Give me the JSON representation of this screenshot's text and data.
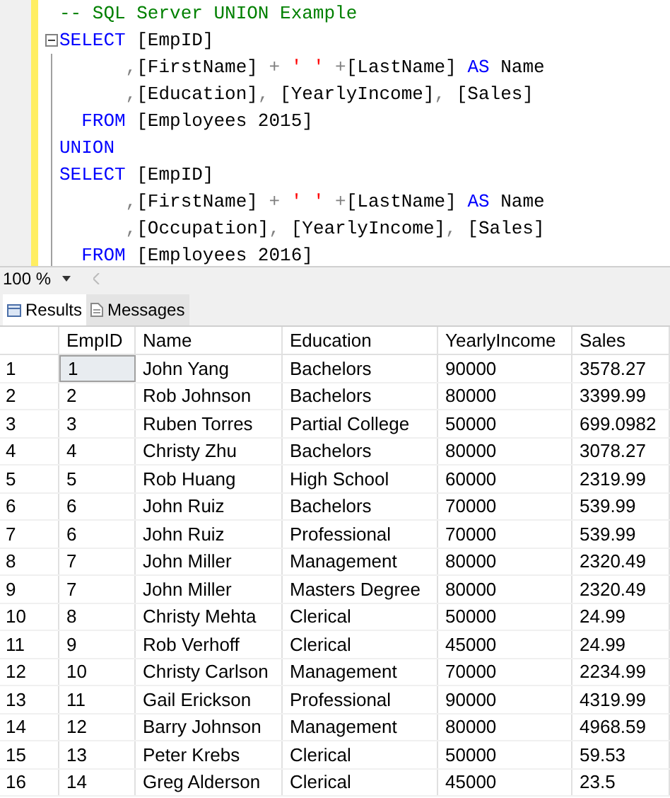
{
  "editor": {
    "lines": [
      {
        "fold": false,
        "tokens": [
          {
            "kind": "comment",
            "text": "-- SQL Server UNION Example"
          }
        ]
      },
      {
        "fold": true,
        "tokens": [
          {
            "kind": "keyword",
            "text": "SELECT"
          },
          {
            "kind": "plain",
            "text": " [EmpID]"
          }
        ]
      },
      {
        "fold": false,
        "tokens": [
          {
            "kind": "punct",
            "text": "      ,"
          },
          {
            "kind": "plain",
            "text": "[FirstName] "
          },
          {
            "kind": "punct",
            "text": "+ "
          },
          {
            "kind": "string",
            "text": "' '"
          },
          {
            "kind": "punct",
            "text": " +"
          },
          {
            "kind": "plain",
            "text": "[LastName] "
          },
          {
            "kind": "keyword",
            "text": "AS"
          },
          {
            "kind": "plain",
            "text": " Name"
          }
        ]
      },
      {
        "fold": false,
        "tokens": [
          {
            "kind": "punct",
            "text": "      ,"
          },
          {
            "kind": "plain",
            "text": "[Education]"
          },
          {
            "kind": "punct",
            "text": ", "
          },
          {
            "kind": "plain",
            "text": "[YearlyIncome]"
          },
          {
            "kind": "punct",
            "text": ", "
          },
          {
            "kind": "plain",
            "text": "[Sales]"
          }
        ]
      },
      {
        "fold": false,
        "tokens": [
          {
            "kind": "keyword",
            "text": "  FROM"
          },
          {
            "kind": "plain",
            "text": " [Employees 2015]"
          }
        ]
      },
      {
        "fold": false,
        "tokens": [
          {
            "kind": "keyword",
            "text": "UNION"
          }
        ]
      },
      {
        "fold": false,
        "tokens": [
          {
            "kind": "keyword",
            "text": "SELECT"
          },
          {
            "kind": "plain",
            "text": " [EmpID]"
          }
        ]
      },
      {
        "fold": false,
        "tokens": [
          {
            "kind": "punct",
            "text": "      ,"
          },
          {
            "kind": "plain",
            "text": "[FirstName] "
          },
          {
            "kind": "punct",
            "text": "+ "
          },
          {
            "kind": "string",
            "text": "' '"
          },
          {
            "kind": "punct",
            "text": " +"
          },
          {
            "kind": "plain",
            "text": "[LastName] "
          },
          {
            "kind": "keyword",
            "text": "AS"
          },
          {
            "kind": "plain",
            "text": " Name"
          }
        ]
      },
      {
        "fold": false,
        "tokens": [
          {
            "kind": "punct",
            "text": "      ,"
          },
          {
            "kind": "plain",
            "text": "[Occupation]"
          },
          {
            "kind": "punct",
            "text": ", "
          },
          {
            "kind": "plain",
            "text": "[YearlyIncome]"
          },
          {
            "kind": "punct",
            "text": ", "
          },
          {
            "kind": "plain",
            "text": "[Sales]"
          }
        ]
      },
      {
        "fold": false,
        "tokens": [
          {
            "kind": "keyword",
            "text": "  FROM"
          },
          {
            "kind": "plain",
            "text": " [Employees 2016]"
          }
        ]
      }
    ]
  },
  "zoom": {
    "value": "100 %"
  },
  "tabs": [
    {
      "label": "Results",
      "selected": true
    },
    {
      "label": "Messages",
      "selected": false
    }
  ],
  "table": {
    "columns": [
      "EmpID",
      "Name",
      "Education",
      "YearlyIncome",
      "Sales"
    ],
    "rows": [
      {
        "row": "1",
        "current": true,
        "cells": [
          "1",
          "John Yang",
          "Bachelors",
          "90000",
          "3578.27"
        ]
      },
      {
        "row": "2",
        "current": false,
        "cells": [
          "2",
          "Rob Johnson",
          "Bachelors",
          "80000",
          "3399.99"
        ]
      },
      {
        "row": "3",
        "current": false,
        "cells": [
          "3",
          "Ruben Torres",
          "Partial College",
          "50000",
          "699.0982"
        ]
      },
      {
        "row": "4",
        "current": false,
        "cells": [
          "4",
          "Christy Zhu",
          "Bachelors",
          "80000",
          "3078.27"
        ]
      },
      {
        "row": "5",
        "current": false,
        "cells": [
          "5",
          "Rob Huang",
          "High School",
          "60000",
          "2319.99"
        ]
      },
      {
        "row": "6",
        "current": false,
        "cells": [
          "6",
          "John Ruiz",
          "Bachelors",
          "70000",
          "539.99"
        ]
      },
      {
        "row": "7",
        "current": false,
        "cells": [
          "6",
          "John Ruiz",
          "Professional",
          "70000",
          "539.99"
        ]
      },
      {
        "row": "8",
        "current": false,
        "cells": [
          "7",
          "John Miller",
          "Management",
          "80000",
          "2320.49"
        ]
      },
      {
        "row": "9",
        "current": false,
        "cells": [
          "7",
          "John Miller",
          "Masters Degree",
          "80000",
          "2320.49"
        ]
      },
      {
        "row": "10",
        "current": false,
        "cells": [
          "8",
          "Christy Mehta",
          "Clerical",
          "50000",
          "24.99"
        ]
      },
      {
        "row": "11",
        "current": false,
        "cells": [
          "9",
          "Rob Verhoff",
          "Clerical",
          "45000",
          "24.99"
        ]
      },
      {
        "row": "12",
        "current": false,
        "cells": [
          "10",
          "Christy Carlson",
          "Management",
          "70000",
          "2234.99"
        ]
      },
      {
        "row": "13",
        "current": false,
        "cells": [
          "11",
          "Gail Erickson",
          "Professional",
          "90000",
          "4319.99"
        ]
      },
      {
        "row": "14",
        "current": false,
        "cells": [
          "12",
          "Barry Johnson",
          "Management",
          "80000",
          "4968.59"
        ]
      },
      {
        "row": "15",
        "current": false,
        "cells": [
          "13",
          "Peter Krebs",
          "Clerical",
          "50000",
          "59.53"
        ]
      },
      {
        "row": "16",
        "current": false,
        "cells": [
          "14",
          "Greg Alderson",
          "Clerical",
          "45000",
          "23.5"
        ]
      }
    ]
  }
}
